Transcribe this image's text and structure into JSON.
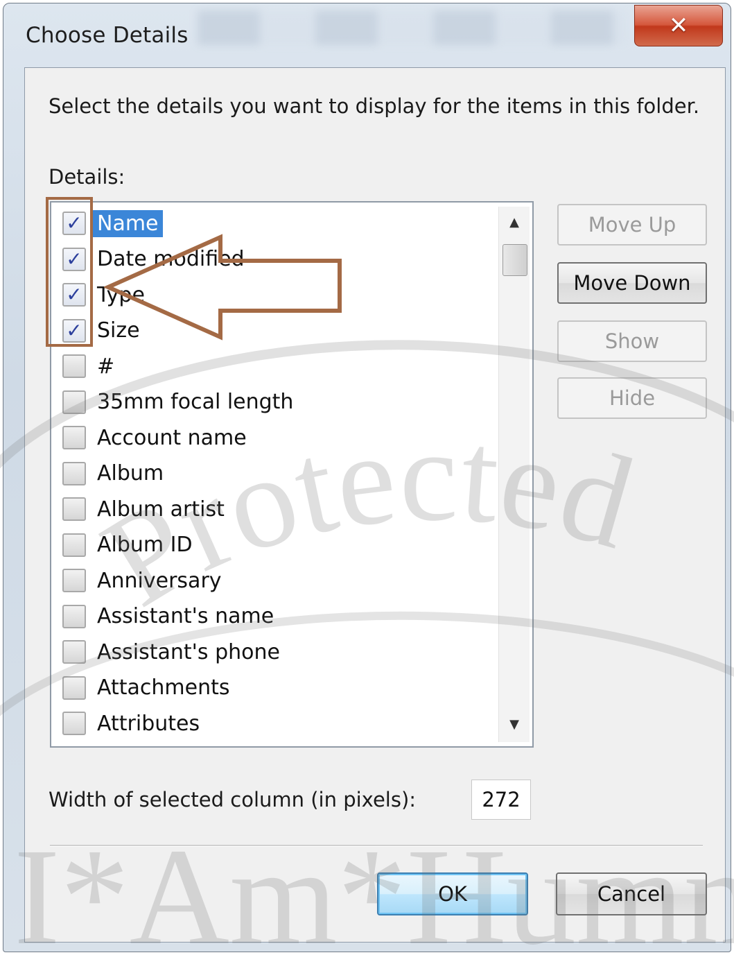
{
  "window": {
    "title": "Choose Details",
    "close_glyph": "✕"
  },
  "instruction": "Select the details you want to display for the items in this folder.",
  "details_label": "Details:",
  "details_list": [
    {
      "label": "Name",
      "checked": true,
      "selected": true
    },
    {
      "label": "Date modified",
      "checked": true,
      "selected": false
    },
    {
      "label": "Type",
      "checked": true,
      "selected": false
    },
    {
      "label": "Size",
      "checked": true,
      "selected": false
    },
    {
      "label": "#",
      "checked": false,
      "selected": false
    },
    {
      "label": "35mm focal length",
      "checked": false,
      "selected": false
    },
    {
      "label": "Account name",
      "checked": false,
      "selected": false
    },
    {
      "label": "Album",
      "checked": false,
      "selected": false
    },
    {
      "label": "Album artist",
      "checked": false,
      "selected": false
    },
    {
      "label": "Album ID",
      "checked": false,
      "selected": false
    },
    {
      "label": "Anniversary",
      "checked": false,
      "selected": false
    },
    {
      "label": "Assistant's name",
      "checked": false,
      "selected": false
    },
    {
      "label": "Assistant's phone",
      "checked": false,
      "selected": false
    },
    {
      "label": "Attachments",
      "checked": false,
      "selected": false
    },
    {
      "label": "Attributes",
      "checked": false,
      "selected": false
    }
  ],
  "check_glyph": "✓",
  "scroll_up_glyph": "▲",
  "scroll_down_glyph": "▼",
  "buttons": {
    "move_up": "Move Up",
    "move_down": "Move Down",
    "show": "Show",
    "hide": "Hide",
    "ok": "OK",
    "cancel": "Cancel"
  },
  "width_label": "Width of selected column (in pixels):",
  "width_value": "272",
  "watermark": {
    "top_text": "Protected",
    "bottom_text": "I*Am*Hummad"
  },
  "colors": {
    "selection": "#3b86d8",
    "annotation": "#a46a45",
    "close_button": "#c1381b",
    "ok_button_border": "#3c7fb1"
  },
  "icons": {
    "close": "close-icon",
    "checkbox": "checkbox-icon",
    "scroll_up": "chevron-up-icon",
    "scroll_down": "chevron-down-icon",
    "annotation_arrow": "left-arrow-icon"
  }
}
